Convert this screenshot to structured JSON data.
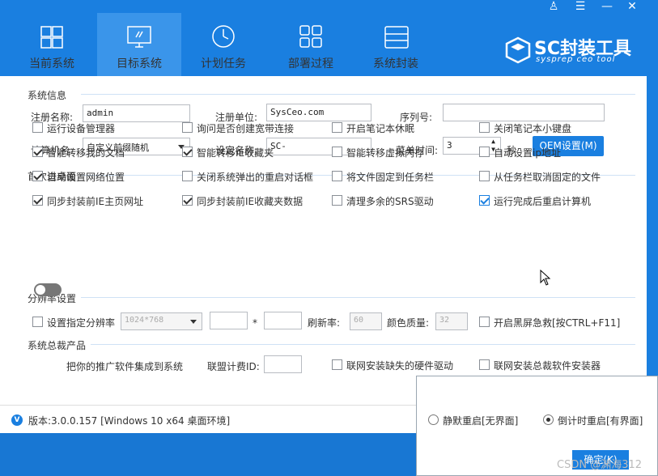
{
  "window": {
    "controls": [
      "♙",
      "☰",
      "—",
      "✕"
    ]
  },
  "tabs": [
    {
      "label": "当前系统",
      "icon": "windows-icon"
    },
    {
      "label": "目标系统",
      "icon": "monitor-icon"
    },
    {
      "label": "计划任务",
      "icon": "clock-icon"
    },
    {
      "label": "部署过程",
      "icon": "grid-icon"
    },
    {
      "label": "系统封装",
      "icon": "server-icon"
    }
  ],
  "brand": {
    "title": "SC封装工具",
    "subtitle": "sysprep ceo tool"
  },
  "system_info": {
    "section": "系统信息",
    "reg_name_label": "注册名称:",
    "reg_name_value": "admin",
    "reg_org_label": "注册单位:",
    "reg_org_value": "SysCeo.com",
    "serial_label": "序列号:",
    "serial_value": "",
    "computer_label": "计算机名:",
    "computer_value": "自定义前缀随机",
    "set_name_label": "设定名称:",
    "set_name_value": "SC-",
    "menu_time_label": "菜单时间:",
    "menu_time_value": "3",
    "menu_time_unit": "秒",
    "oem_button": "OEM设置(M)"
  },
  "first_desktop": {
    "section": "首次进桌面",
    "options": [
      {
        "label": "运行设备管理器",
        "checked": false
      },
      {
        "label": "询问是否创建宽带连接",
        "checked": false
      },
      {
        "label": "开启笔记本休眠",
        "checked": false
      },
      {
        "label": "关闭笔记本小键盘",
        "checked": false
      },
      {
        "label": "智能转移我的文档",
        "checked": true
      },
      {
        "label": "智能转移IE收藏夹",
        "checked": true
      },
      {
        "label": "智能转移虚拟内存",
        "checked": false
      },
      {
        "label": "自动设置ip地址",
        "checked": false
      },
      {
        "label": "自动设置网络位置",
        "checked": true
      },
      {
        "label": "关闭系统弹出的重启对话框",
        "checked": false
      },
      {
        "label": "将文件固定到任务栏",
        "checked": false
      },
      {
        "label": "从任务栏取消固定的文件",
        "checked": false
      },
      {
        "label": "同步封装前IE主页网址",
        "checked": true
      },
      {
        "label": "同步封装前IE收藏夹数据",
        "checked": true
      },
      {
        "label": "清理多余的SRS驱动",
        "checked": false
      },
      {
        "label": "运行完成后重启计算机",
        "checked": true
      }
    ]
  },
  "resolution": {
    "section": "分辨率设置",
    "set_label": "设置指定分辨率",
    "set_checked": false,
    "preset_value": "1024*768",
    "width_value": "",
    "times": "*",
    "height_value": "",
    "refresh_label": "刷新率:",
    "refresh_value": "60",
    "color_label": "颜色质量:",
    "color_value": "32",
    "blackscreen_label": "开启黑屏急救[按CTRL+F11]",
    "blackscreen_checked": false
  },
  "ceo_products": {
    "section": "系统总裁产品",
    "toggle_label": "把你的推广软件集成到系统",
    "toggle_on": false,
    "union_label": "联盟计费ID:",
    "union_value": "",
    "driver_label": "联网安装缺失的硬件驱动",
    "driver_checked": false,
    "installer_label": "联网安装总裁软件安装器",
    "installer_checked": false
  },
  "status": {
    "badge": "V",
    "version_text": "版本:3.0.0.157 [Windows 10 x64 桌面环境]"
  },
  "popup": {
    "silent_label": "静默重启[无界面]",
    "silent_selected": false,
    "countdown_label": "倒计时重启[有界面]",
    "countdown_selected": true,
    "confirm_button": "确定(K)"
  },
  "watermark": "CSDN @渊海312",
  "colors": {
    "accent": "#1a7fe0",
    "header": "#1a7fe0",
    "active_tab": "#3a95ea"
  }
}
